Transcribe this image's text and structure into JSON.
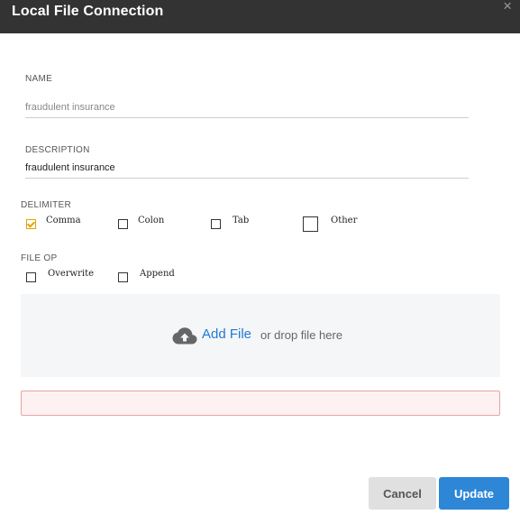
{
  "dialog": {
    "title": "Local File Connection",
    "close_glyph": "×"
  },
  "name": {
    "label": "NAME",
    "value": "",
    "placeholder": "fraudulent insurance"
  },
  "description": {
    "label": "DESCRIPTION",
    "value": "fraudulent insurance",
    "placeholder": ""
  },
  "delimiter": {
    "label": "DELIMITER",
    "options": [
      {
        "label": "Comma",
        "checked": true
      },
      {
        "label": "Colon",
        "checked": false
      },
      {
        "label": "Tab",
        "checked": false
      },
      {
        "label": "Other",
        "checked": false
      }
    ]
  },
  "file_op": {
    "label": "FILE OP",
    "options": [
      {
        "label": "Overwrite",
        "checked": false
      },
      {
        "label": "Append",
        "checked": false
      }
    ]
  },
  "dropzone": {
    "icon": "cloud-upload-icon",
    "add_file_label": "Add File",
    "drop_text": "or drop file here"
  },
  "buttons": {
    "cancel_label": "Cancel",
    "update_label": "Update"
  },
  "colors": {
    "titlebar": "#333333",
    "accent": "#2d86d6",
    "check": "#e2a600",
    "error_border": "#e6a5a5",
    "error_bg": "#fdf1f1"
  }
}
